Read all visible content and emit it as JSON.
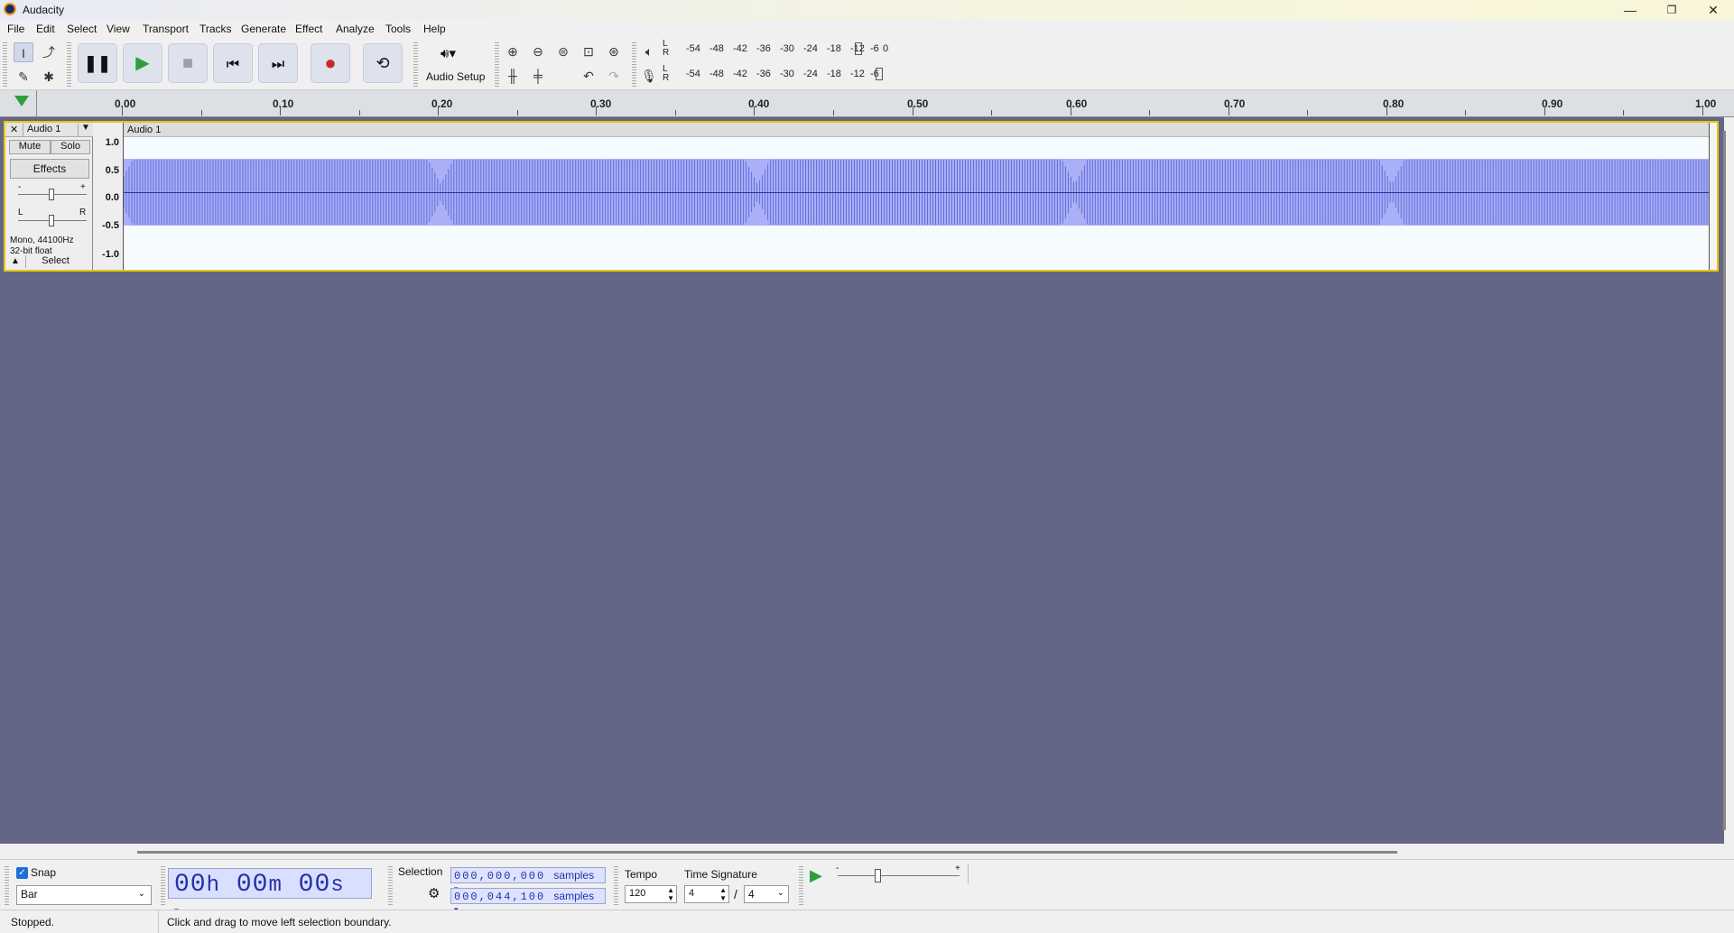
{
  "window": {
    "title": "Audacity",
    "controls": {
      "minimize": "—",
      "maximize": "❐",
      "close": "✕"
    }
  },
  "menu": [
    "File",
    "Edit",
    "Select",
    "View",
    "Transport",
    "Tracks",
    "Generate",
    "Effect",
    "Analyze",
    "Tools",
    "Help"
  ],
  "toolbar": {
    "audio_setup_label": "Audio Setup",
    "meter_scale": [
      "-54",
      "-48",
      "-42",
      "-36",
      "-30",
      "-24",
      "-18",
      "-12",
      "-6",
      "0"
    ],
    "meter_scale_rec": [
      "-54",
      "-48",
      "-42",
      "-36",
      "-30",
      "-24",
      "-18",
      "-12",
      "-6"
    ],
    "meter_channels": [
      "L",
      "R"
    ]
  },
  "ruler": {
    "labels": [
      "0.00",
      "0.10",
      "0.20",
      "0.30",
      "0.40",
      "0.50",
      "0.60",
      "0.70",
      "0.80",
      "0.90",
      "1.00"
    ]
  },
  "track": {
    "name": "Audio 1",
    "clip_name": "Audio 1",
    "mute_label": "Mute",
    "solo_label": "Solo",
    "effects_label": "Effects",
    "gain_min": "-",
    "gain_max": "+",
    "pan_left": "L",
    "pan_right": "R",
    "info_line1": "Mono, 44100Hz",
    "info_line2": "32-bit float",
    "select_label": "Select",
    "close_label": "✕",
    "collapse_label": "▲",
    "vruler_labels": [
      "1.0",
      "0.5",
      "0.0",
      "-0.5",
      "-1.0"
    ],
    "waveform_color": "#4a56d6",
    "waveform_dips_seconds": [
      0.2,
      0.4,
      0.6,
      0.8
    ]
  },
  "bottom": {
    "snap_label": "Snap",
    "snap_checked": true,
    "snap_value": "Bar",
    "time_display": {
      "d1": "00",
      "u1": "h",
      "d2": "00",
      "u2": "m",
      "d3": "00",
      "u3": "s"
    },
    "selection_label": "Selection",
    "selection_start": "000,000,000",
    "selection_end": "000,044,100",
    "selection_unit": "samples",
    "tempo_label": "Tempo",
    "tempo_value": "120",
    "time_sig_label": "Time Signature",
    "time_sig_num": "4",
    "time_sig_sep": "/",
    "time_sig_den": "4",
    "speed_min": "-",
    "speed_max": "+"
  },
  "status": {
    "state": "Stopped.",
    "hint": "Click and drag to move left selection boundary."
  },
  "colors": {
    "accent_record": "#c62828",
    "play_green": "#2e9e3a",
    "track_bg": "#636685",
    "selected_border": "#e6c800",
    "time_digits": "#2530a8"
  }
}
